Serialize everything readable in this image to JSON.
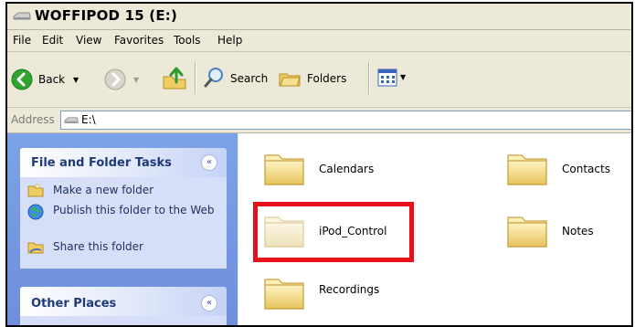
{
  "window": {
    "title": "WOFFIPOD 15 (E:)"
  },
  "menu": [
    "File",
    "Edit",
    "View",
    "Favorites",
    "Tools",
    "Help"
  ],
  "toolbar": {
    "back": "Back",
    "search": "Search",
    "folders": "Folders"
  },
  "address": {
    "label": "Address",
    "value": "E:\\"
  },
  "tasks": {
    "title": "File and Folder Tasks",
    "items": [
      "Make a new folder",
      "Publish this folder to the Web",
      "Share this folder"
    ],
    "collapse_glyph": "«"
  },
  "other_places": {
    "title": "Other Places",
    "collapse_glyph": "«"
  },
  "folders": [
    {
      "name": "Calendars"
    },
    {
      "name": "Contacts"
    },
    {
      "name": "iPod_Control"
    },
    {
      "name": "Notes"
    },
    {
      "name": "Recordings"
    }
  ],
  "colors": {
    "highlight": "#e8101a",
    "taskpane": "#7ba2e7",
    "folder": "#f3d77a"
  }
}
